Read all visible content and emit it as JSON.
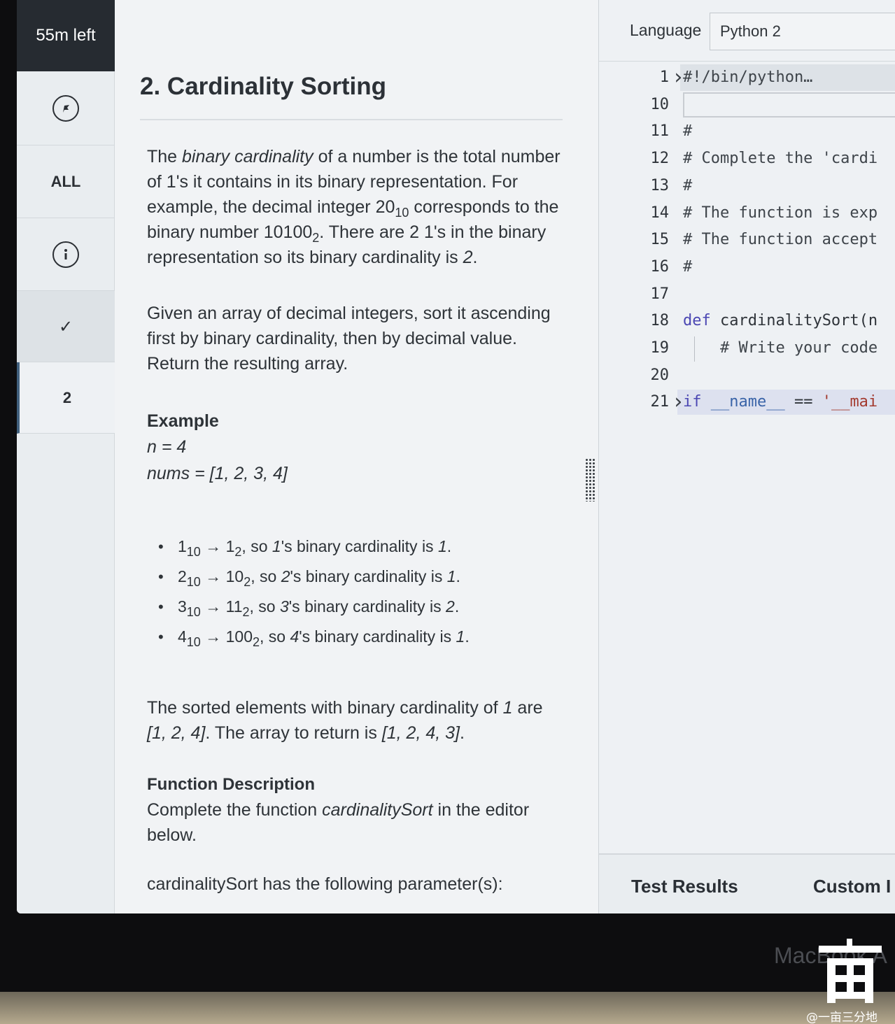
{
  "timer": {
    "label": "55m left"
  },
  "rail": {
    "all_label": "ALL",
    "current_question": "2"
  },
  "problem": {
    "title": "2. Cardinality Sorting",
    "p1": {
      "a": "The ",
      "b": "binary cardinality",
      "c": " of a number is the total number of 1's it contains in its binary representation. For example, the decimal integer ",
      "d": "20",
      "e": "10",
      "f": " corresponds to the binary number ",
      "g": "10100",
      "h": "2",
      "i": ". There are 2 1's in the binary representation so its binary cardinality is ",
      "j": "2",
      "k": "."
    },
    "p2": "Given an array of decimal integers, sort it ascending first by binary cardinality, then by decimal value. Return the resulting array.",
    "example": {
      "heading": "Example",
      "n_line": "n = 4",
      "nums_line": "nums = [1, 2, 3, 4]"
    },
    "bullets": [
      {
        "dec": "1",
        "bin": "1",
        "num": "1",
        "card": "1"
      },
      {
        "dec": "2",
        "bin": "10",
        "num": "2",
        "card": "1"
      },
      {
        "dec": "3",
        "bin": "11",
        "num": "3",
        "card": "2"
      },
      {
        "dec": "4",
        "bin": "100",
        "num": "4",
        "card": "1"
      }
    ],
    "bullet_text": {
      "base10": "10",
      "base2": "2",
      "arrow": " → ",
      "so": ", so ",
      "s_binary": "'s binary cardinality is ",
      "period": "."
    },
    "sorted": {
      "a": "The sorted elements with binary cardinality of ",
      "b": "1",
      "c": " are ",
      "d": "[1, 2, 4]",
      "e": ". The array to return is ",
      "f": "[1, 2, 4, 3]",
      "g": "."
    },
    "function_description": {
      "heading": "Function Description",
      "a": "Complete the function ",
      "b": "cardinalitySort",
      "c": " in the editor below."
    },
    "params_line": "cardinalitySort has the following parameter(s):"
  },
  "editor": {
    "language_label": "Language",
    "language_value": "Python 2",
    "lines": [
      {
        "num": "1",
        "text": "#!/bin/python…"
      },
      {
        "num": "10",
        "text": ""
      },
      {
        "num": "11",
        "text": "#"
      },
      {
        "num": "12",
        "text": "# Complete the 'cardi"
      },
      {
        "num": "13",
        "text": "#"
      },
      {
        "num": "14",
        "text": "# The function is exp"
      },
      {
        "num": "15",
        "text": "# The function accept"
      },
      {
        "num": "16",
        "text": "#"
      },
      {
        "num": "17",
        "text": ""
      },
      {
        "num": "18",
        "kw": "def",
        "text": " cardinalitySort(n"
      },
      {
        "num": "19",
        "text": "    # Write your code"
      },
      {
        "num": "20",
        "text": ""
      },
      {
        "num": "21",
        "kw": "if",
        "name": " __name__",
        "op": " == ",
        "str": "'__mai"
      }
    ],
    "tabs": {
      "test_results": "Test Results",
      "custom_input": "Custom I"
    }
  },
  "device": {
    "brand": "MacBook A",
    "watermark_text": "@一亩三分地"
  }
}
